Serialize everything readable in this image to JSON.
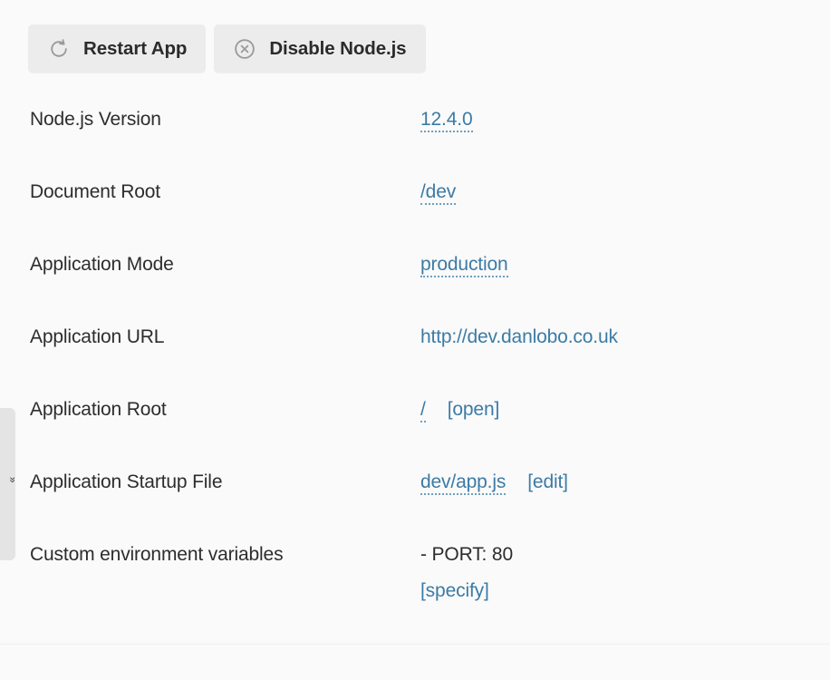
{
  "toolbar": {
    "buttons": [
      {
        "label": "Restart App",
        "icon": "restart-icon"
      },
      {
        "label": "Disable Node.js",
        "icon": "disable-circle-x-icon"
      }
    ]
  },
  "side_tab": {
    "label": "«"
  },
  "colors": {
    "page_background": "#fafafa",
    "button_background": "#ececec",
    "link": "#3c7ba5",
    "text": "#2d2d2d",
    "side_tab": "#e4e4e4"
  },
  "info_rows": [
    {
      "label": "Node.js Version",
      "name": "nodejs-version",
      "parts": [
        {
          "kind": "link",
          "text": "12.4.0",
          "style": "dotted",
          "name": "nodejs-version-link"
        }
      ]
    },
    {
      "label": "Document Root",
      "name": "document-root",
      "parts": [
        {
          "kind": "link",
          "text": "/dev",
          "style": "dotted",
          "name": "document-root-link"
        }
      ]
    },
    {
      "label": "Application Mode",
      "name": "application-mode",
      "parts": [
        {
          "kind": "link",
          "text": "production",
          "style": "dotted",
          "name": "application-mode-link"
        }
      ]
    },
    {
      "label": "Application URL",
      "name": "application-url",
      "parts": [
        {
          "kind": "link",
          "text": "http://dev.danlobo.co.uk",
          "style": "plain",
          "name": "application-url-link"
        }
      ]
    },
    {
      "label": "Application Root",
      "name": "application-root",
      "parts": [
        {
          "kind": "link",
          "text": "/",
          "style": "dotted",
          "name": "application-root-link"
        },
        {
          "kind": "gap"
        },
        {
          "kind": "gap"
        },
        {
          "kind": "link",
          "text": "[open]",
          "style": "plain",
          "name": "application-root-open-link"
        }
      ]
    },
    {
      "label": "Application Startup File",
      "name": "application-startup-file",
      "parts": [
        {
          "kind": "link",
          "text": "dev/app.js",
          "style": "dotted",
          "name": "application-startup-file-link"
        },
        {
          "kind": "gap"
        },
        {
          "kind": "gap"
        },
        {
          "kind": "link",
          "text": "[edit]",
          "style": "plain",
          "name": "application-startup-file-edit-link"
        }
      ]
    },
    {
      "label": "Custom environment variables",
      "name": "custom-environment-variables",
      "parts": [
        {
          "kind": "text",
          "text": "- PORT: 80",
          "name": "custom-env-value"
        },
        {
          "kind": "break"
        },
        {
          "kind": "link",
          "text": "[specify]",
          "style": "plain",
          "name": "custom-env-specify-link"
        }
      ]
    }
  ]
}
